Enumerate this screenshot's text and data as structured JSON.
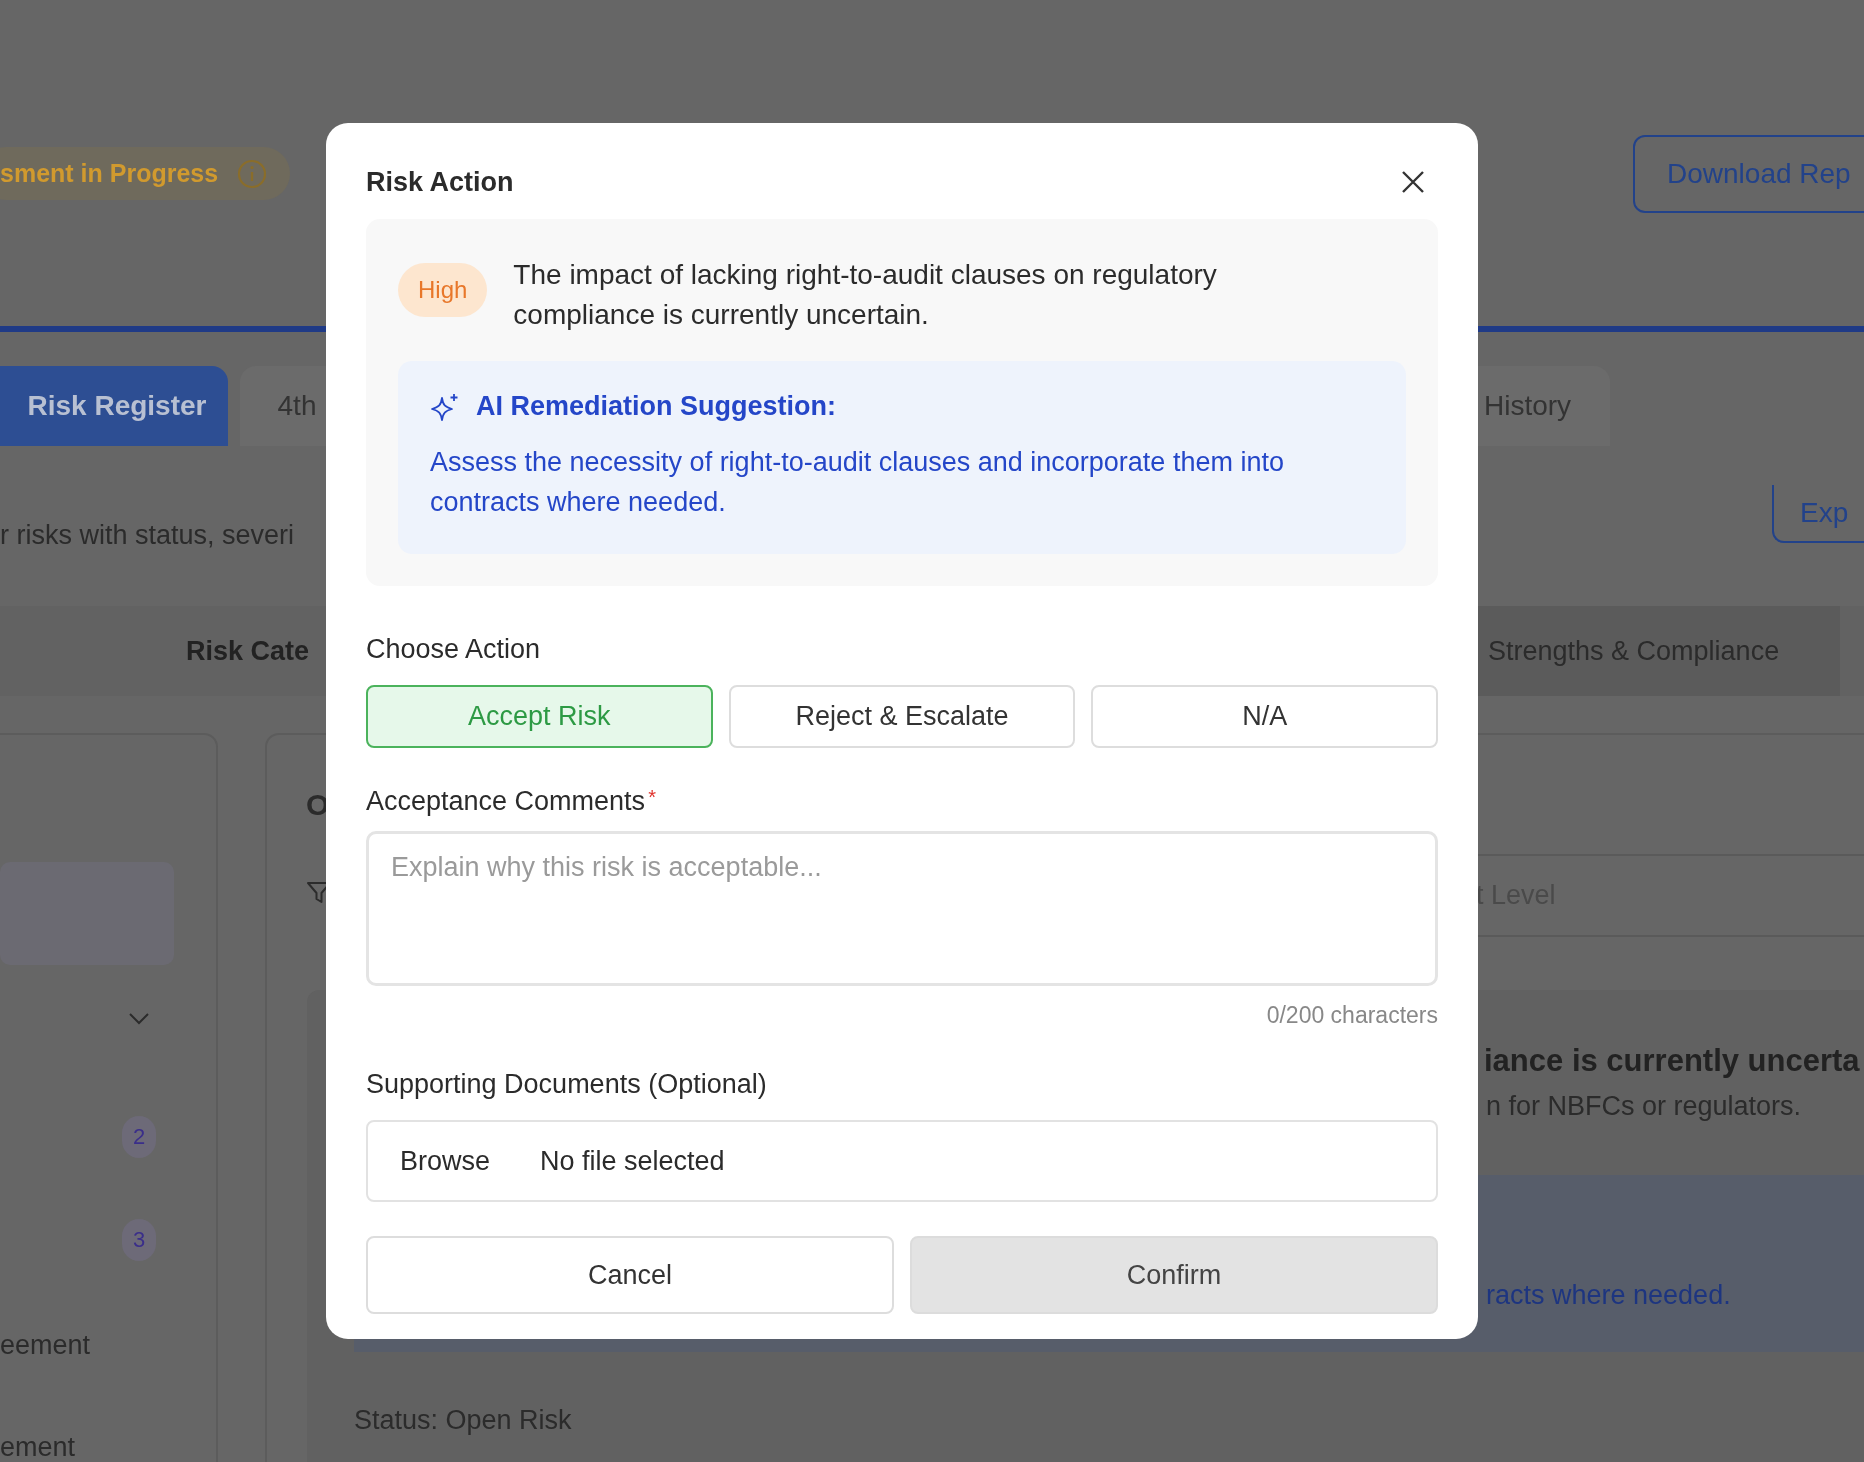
{
  "background": {
    "status_pill": "sment in Progress",
    "download_button": "Download Rep",
    "tabs": [
      {
        "label": "Risk Register",
        "selected": true
      },
      {
        "label": "4th",
        "selected": false
      },
      {
        "label": "History",
        "selected": false
      }
    ],
    "description": "r risks with status, severi",
    "export_button": "Exp",
    "category_bar": {
      "left": "Risk Cate",
      "right": "Strengths & Compliance"
    },
    "sidebar": {
      "badges": [
        "2",
        "3"
      ],
      "items": [
        "eement",
        "ement"
      ]
    },
    "panel": {
      "heading": "O",
      "field_placeholder": "t Level",
      "risk_title": "iance is currently uncerta",
      "risk_detail": "n for NBFCs or regulators.",
      "suggestion": "racts where needed.",
      "status": "Status: Open Risk"
    }
  },
  "modal": {
    "title": "Risk Action",
    "severity": "High",
    "description": "The impact of lacking right-to-audit clauses on regulatory compliance is currently uncertain.",
    "suggestion": {
      "title": "AI Remediation Suggestion:",
      "text": "Assess the necessity of right-to-audit clauses and incorporate them into contracts where needed."
    },
    "choose_action_label": "Choose Action",
    "actions": [
      {
        "label": "Accept Risk",
        "selected": true
      },
      {
        "label": "Reject & Escalate",
        "selected": false
      },
      {
        "label": "N/A",
        "selected": false
      }
    ],
    "comments": {
      "label": "Acceptance Comments",
      "required_mark": "*",
      "placeholder": "Explain why this risk is acceptable...",
      "counter": "0/200 characters"
    },
    "documents": {
      "label": "Supporting Documents (Optional)",
      "browse_label": "Browse",
      "file_status": "No file selected"
    },
    "buttons": [
      {
        "label": "Cancel",
        "kind": "secondary",
        "disabled": false
      },
      {
        "label": "Confirm",
        "kind": "primary",
        "disabled": true
      }
    ]
  }
}
